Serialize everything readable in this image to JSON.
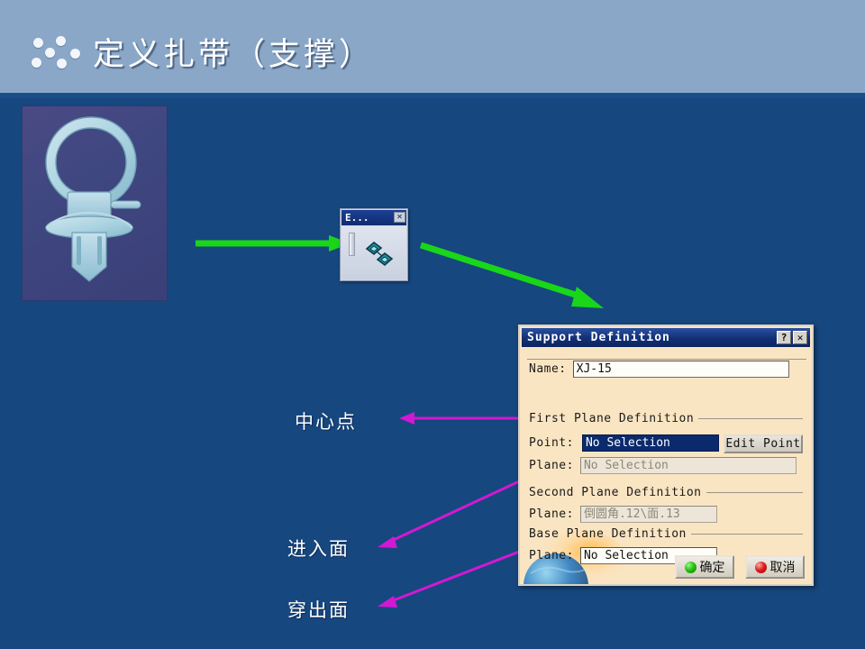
{
  "header": {
    "title": "定义扎带（支撑）",
    "dots_icon": "six-dots-decoration"
  },
  "thumbnail": {
    "name": "cad-clip-render",
    "alt": "扎带支撑 3D 模型"
  },
  "mini_toolbar": {
    "title": "E...",
    "close_label": "✕",
    "icon_name": "support-definition-icon",
    "grip_name": "toolbar-grip"
  },
  "callouts": {
    "center_point": "中心点",
    "entry_face": "进入面",
    "exit_face": "穿出面"
  },
  "dialog": {
    "title": "Support Definition",
    "help_label": "?",
    "close_label": "✕",
    "name_label": "Name:",
    "name_value": "XJ-15",
    "first_plane_group": "First Plane Definition",
    "point_label": "Point:",
    "point_value": "No Selection",
    "edit_point_label": "Edit Point",
    "first_plane_label": "Plane:",
    "first_plane_value": "No Selection",
    "second_plane_group": "Second Plane Definition",
    "second_plane_label": "Plane:",
    "second_plane_value": "倒圆角.12\\面.13",
    "base_plane_group": "Base Plane Definition",
    "base_plane_label": "Plane:",
    "base_plane_value": "No Selection",
    "ok_label": "确定",
    "cancel_label": "取消"
  },
  "colors": {
    "header_bg": "#8aa7c8",
    "body_bg": "#16477f",
    "accent_bar": "#1b4d88",
    "green_arrow": "#19d619",
    "magenta_arrow": "#d318d3",
    "dialog_bg": "#fae5c3",
    "dialog_titlebar": "#123072"
  }
}
